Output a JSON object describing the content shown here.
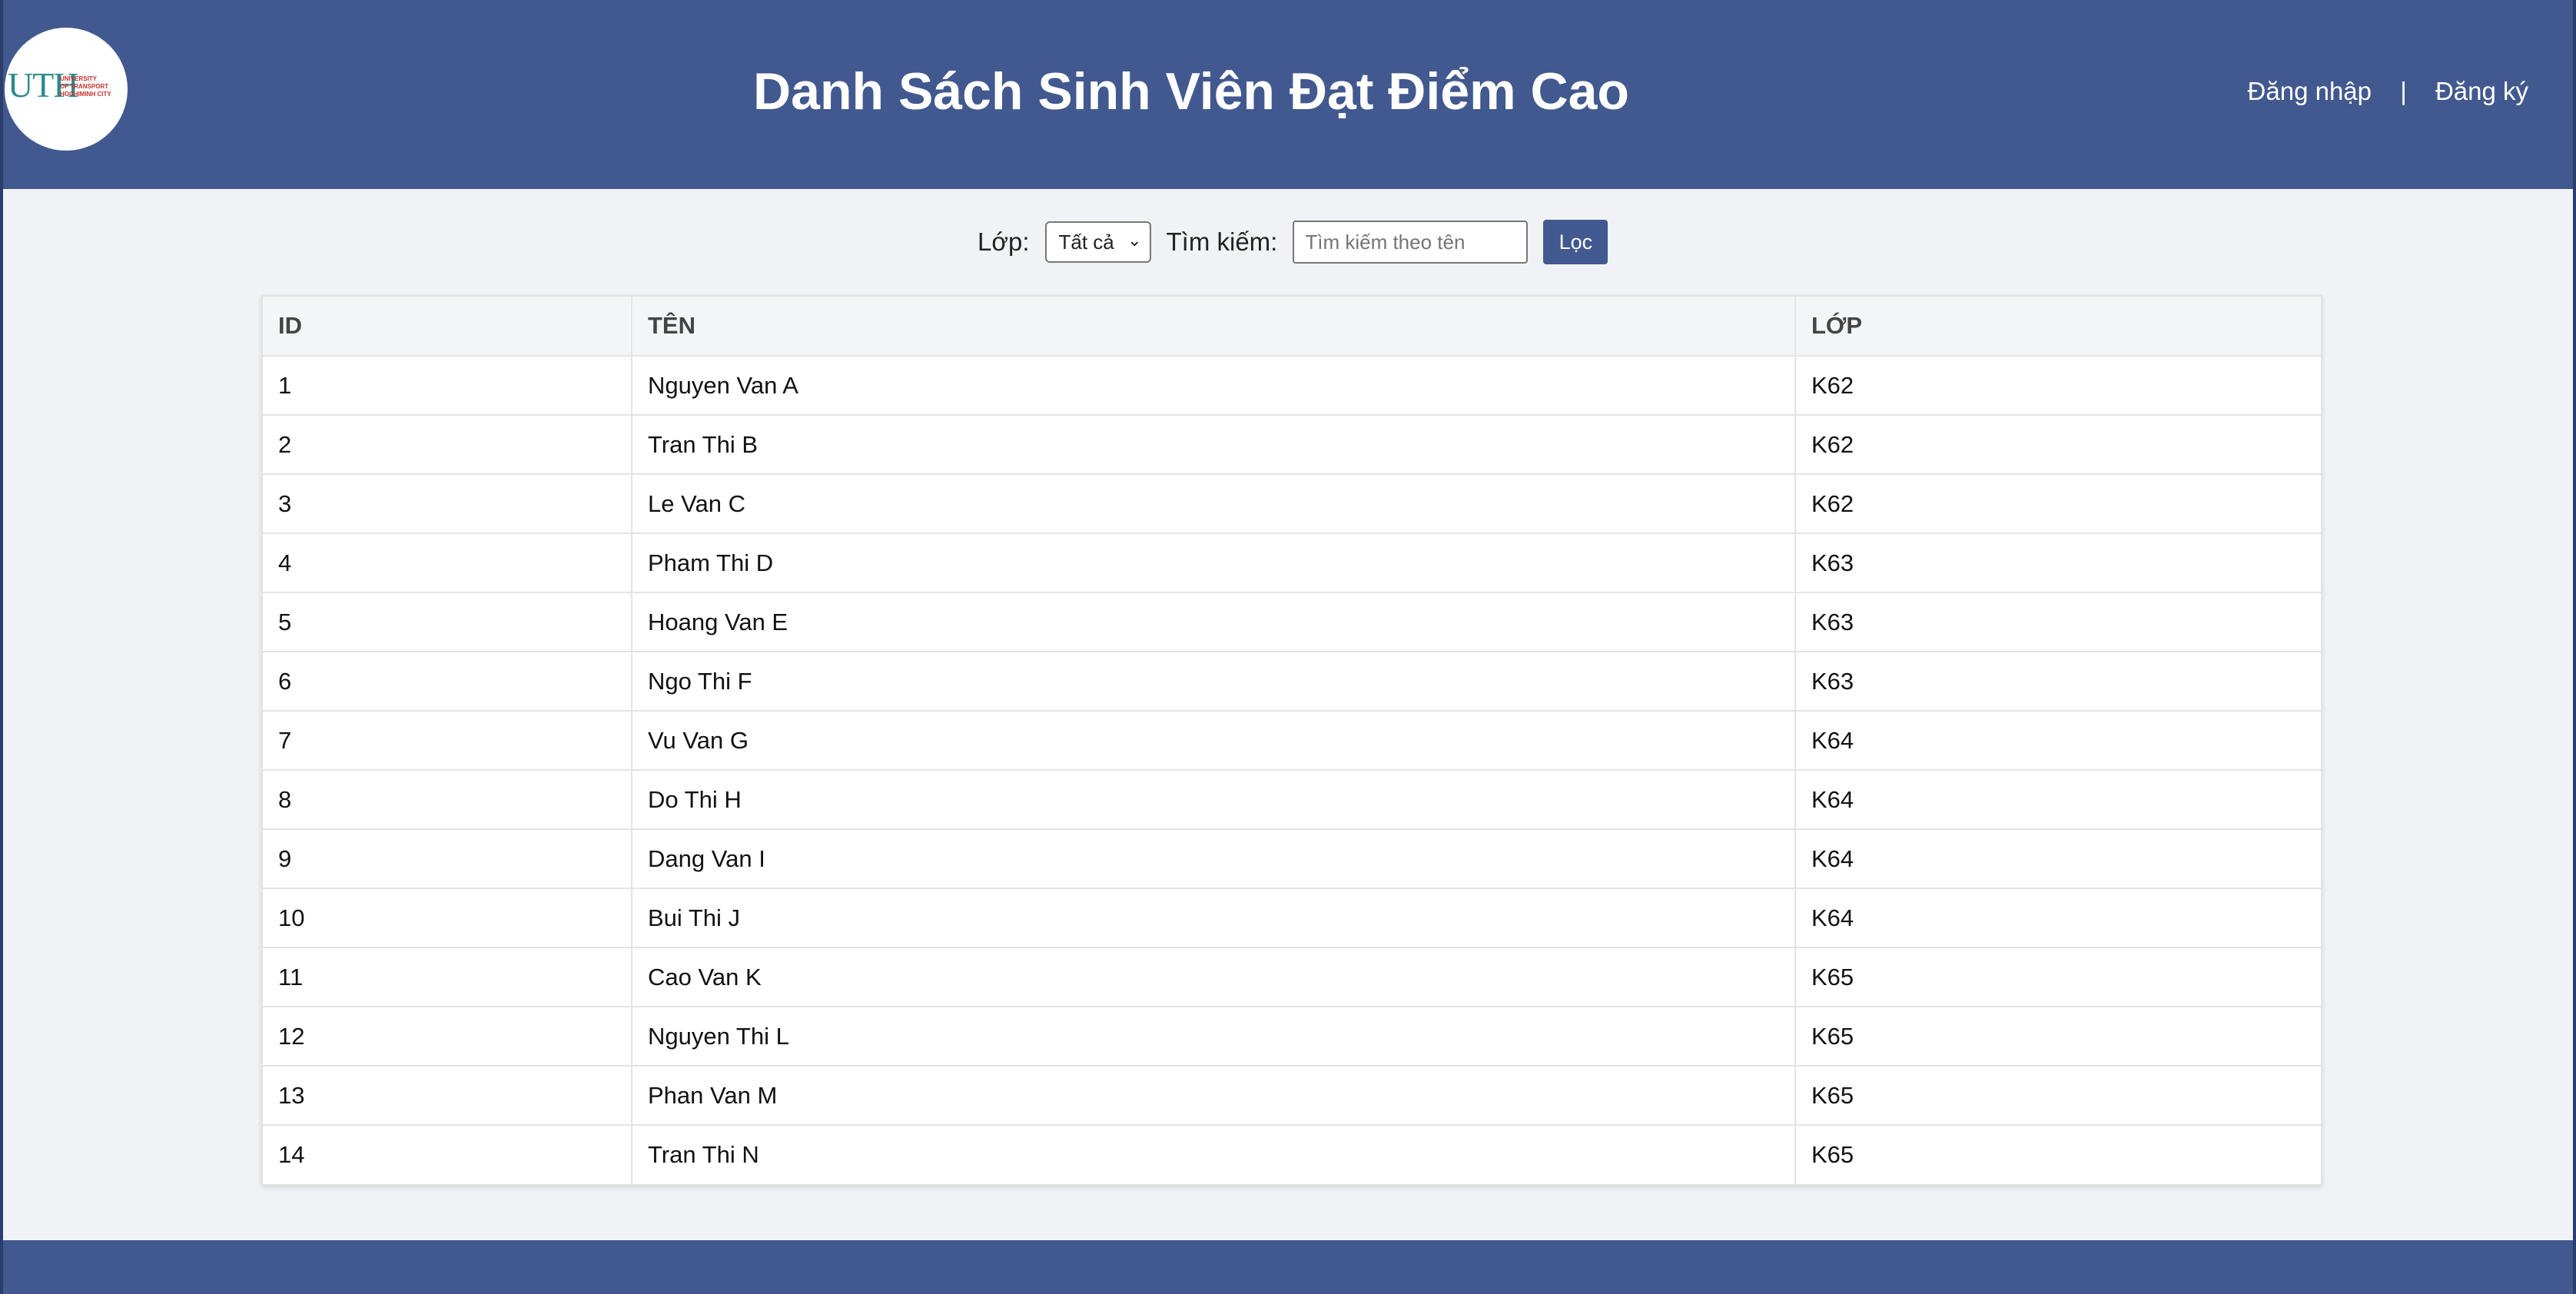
{
  "header": {
    "logo": {
      "text": "UTH",
      "lines": [
        "UNIVERSITY",
        "OF TRANSPORT",
        "HOCHIMINH CITY"
      ]
    },
    "title": "Danh Sách Sinh Viên Đạt Điểm Cao",
    "nav": {
      "login": "Đăng nhập",
      "separator": "|",
      "register": "Đăng ký"
    }
  },
  "filter": {
    "class_label": "Lớp:",
    "class_selected": "Tất cả",
    "search_label": "Tìm kiếm:",
    "search_placeholder": "Tìm kiếm theo tên",
    "search_value": "",
    "filter_button": "Lọc"
  },
  "table": {
    "columns": [
      "ID",
      "TÊN",
      "LỚP"
    ],
    "rows": [
      [
        "1",
        "Nguyen Van A",
        "K62"
      ],
      [
        "2",
        "Tran Thi B",
        "K62"
      ],
      [
        "3",
        "Le Van C",
        "K62"
      ],
      [
        "4",
        "Pham Thi D",
        "K63"
      ],
      [
        "5",
        "Hoang Van E",
        "K63"
      ],
      [
        "6",
        "Ngo Thi F",
        "K63"
      ],
      [
        "7",
        "Vu Van G",
        "K64"
      ],
      [
        "8",
        "Do Thi H",
        "K64"
      ],
      [
        "9",
        "Dang Van I",
        "K64"
      ],
      [
        "10",
        "Bui Thi J",
        "K64"
      ],
      [
        "11",
        "Cao Van K",
        "K65"
      ],
      [
        "12",
        "Nguyen Thi L",
        "K65"
      ],
      [
        "13",
        "Phan Van M",
        "K65"
      ],
      [
        "14",
        "Tran Thi N",
        "K65"
      ]
    ]
  },
  "colors": {
    "primary": "#42598f",
    "background": "#f1f2f6",
    "logo_teal": "#2a8a8a",
    "logo_red": "#c8302b"
  }
}
